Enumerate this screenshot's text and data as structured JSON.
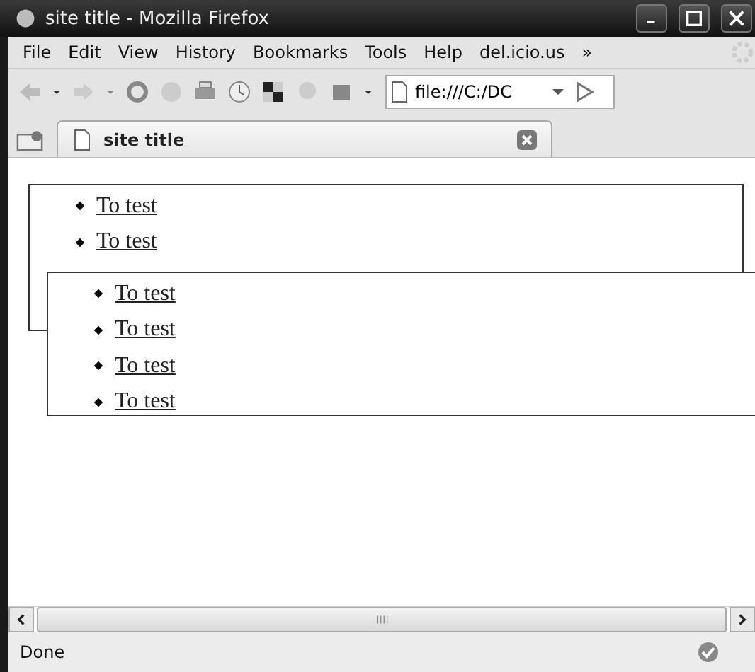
{
  "window": {
    "title": "site title - Mozilla Firefox"
  },
  "menu": [
    "File",
    "Edit",
    "View",
    "History",
    "Bookmarks",
    "Tools",
    "Help",
    "del.icio.us",
    "»"
  ],
  "address": {
    "value": "file:///C:/DC"
  },
  "tabs": [
    {
      "label": "site title",
      "selected": true
    }
  ],
  "page": {
    "boxes": [
      {
        "links": [
          "To test",
          "To test"
        ]
      },
      {
        "links": [
          "To test",
          "To test",
          "To test",
          "To test"
        ]
      }
    ]
  },
  "status_bar": {
    "text": "Done"
  }
}
